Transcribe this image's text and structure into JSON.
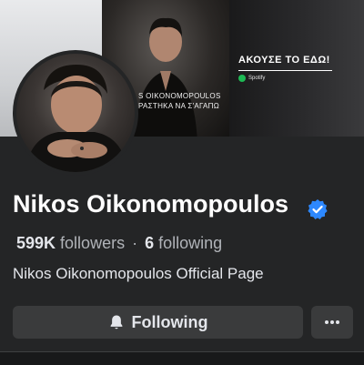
{
  "cover": {
    "album_artist": "S OIKONOMOPOULOS",
    "album_title": "ΡΑΣΤΗΚΑ ΝΑ Σ'ΑΓΑΠΩ",
    "listen_cta": "ΑΚΟΥΣΕ ΤΟ ΕΔΩ!",
    "streaming_service": "Spotify"
  },
  "profile": {
    "name": "Nikos Oikonomopoulos",
    "verified": true,
    "followers_count": "599K",
    "followers_label": "followers",
    "separator": "·",
    "following_count": "6",
    "following_label": "following",
    "bio": "Nikos Oikonomopoulos Official Page"
  },
  "actions": {
    "following_label": "Following",
    "following_icon": "bell-icon",
    "more_icon": "more-icon"
  },
  "colors": {
    "background": "#242526",
    "button": "#3a3b3c",
    "verified_badge": "#2d88ff",
    "spotify": "#1db954"
  }
}
